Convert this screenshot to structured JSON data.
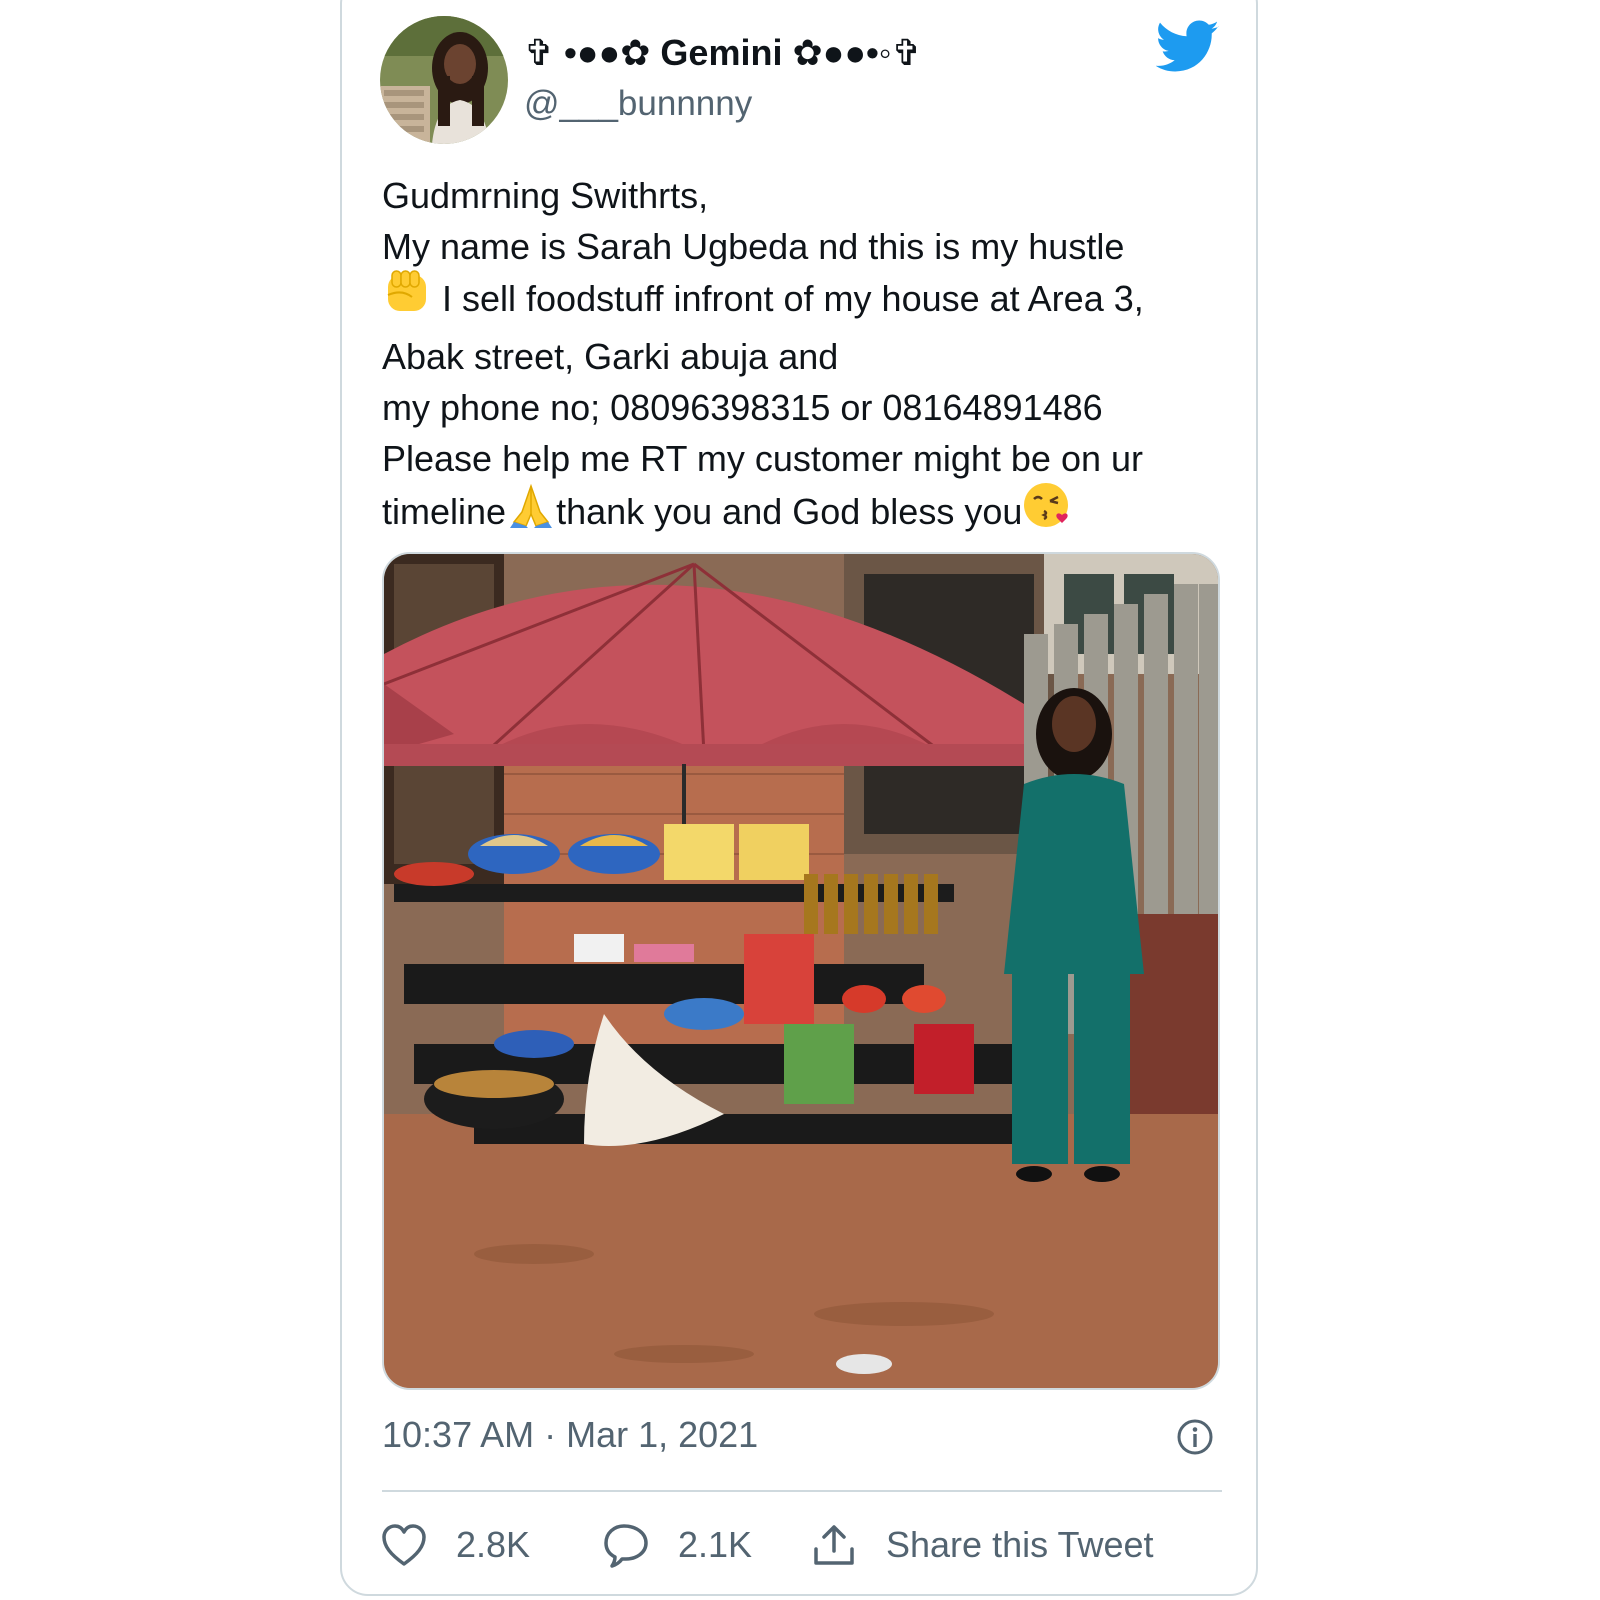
{
  "tweet": {
    "author": {
      "display_name": "✞ •●●✿ Gemini ✿●●•◦✞",
      "handle": "@___bunnnny"
    },
    "text_lines": [
      "Gudmrning Swithrts,",
      "My name is Sarah Ugbeda nd this is my hustle",
      " I sell foodstuff infront of my house at Area 3,",
      "Abak street, Garki abuja and",
      " my phone no; 08096398315 or 08164891486",
      "Please help me RT my customer might be on ur",
      "timeline",
      "thank you and God bless you"
    ],
    "timestamp": "10:37 AM · Mar 1, 2021",
    "likes": "2.8K",
    "replies": "2.1K",
    "share_label": "Share this Tweet"
  },
  "icons": {
    "brand": "twitter-bird-icon",
    "like": "heart-icon",
    "reply": "speech-bubble-icon",
    "share": "share-upload-icon",
    "info": "info-icon",
    "emoji_fist": "raised-fist-emoji",
    "emoji_pray": "folded-hands-emoji",
    "emoji_kiss": "face-blowing-kiss-emoji"
  },
  "colors": {
    "brand_blue": "#1d9bf0",
    "text": "#0f1419",
    "secondary_text": "#536471",
    "border": "#cfd9de",
    "umbrella": "#c0505a",
    "suit_green": "#13706a"
  }
}
